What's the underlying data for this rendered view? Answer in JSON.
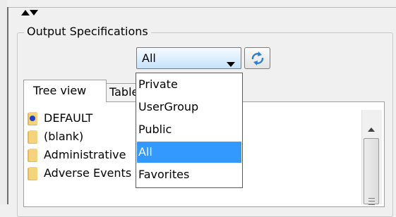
{
  "group": {
    "title": "Output Specifications"
  },
  "filter_combo": {
    "value": "All"
  },
  "tabs": [
    {
      "label": "Tree view"
    },
    {
      "label": "Table view"
    }
  ],
  "tree": {
    "items": [
      {
        "label": "DEFAULT",
        "icon": "blue-bullet-icon"
      },
      {
        "label": "(blank)",
        "icon": "folder-icon"
      },
      {
        "label": "Administrative",
        "icon": "folder-icon"
      },
      {
        "label": "Adverse Events",
        "icon": "folder-icon"
      }
    ]
  },
  "dropdown": {
    "options": [
      "Private",
      "UserGroup",
      "Public",
      "All",
      "Favorites"
    ],
    "selected": "All"
  },
  "colors": {
    "selection": "#3399ff",
    "combo_gradient_top": "#f7fbff",
    "combo_gradient_bottom": "#c3e3fb",
    "folder": "#e9b94a"
  }
}
